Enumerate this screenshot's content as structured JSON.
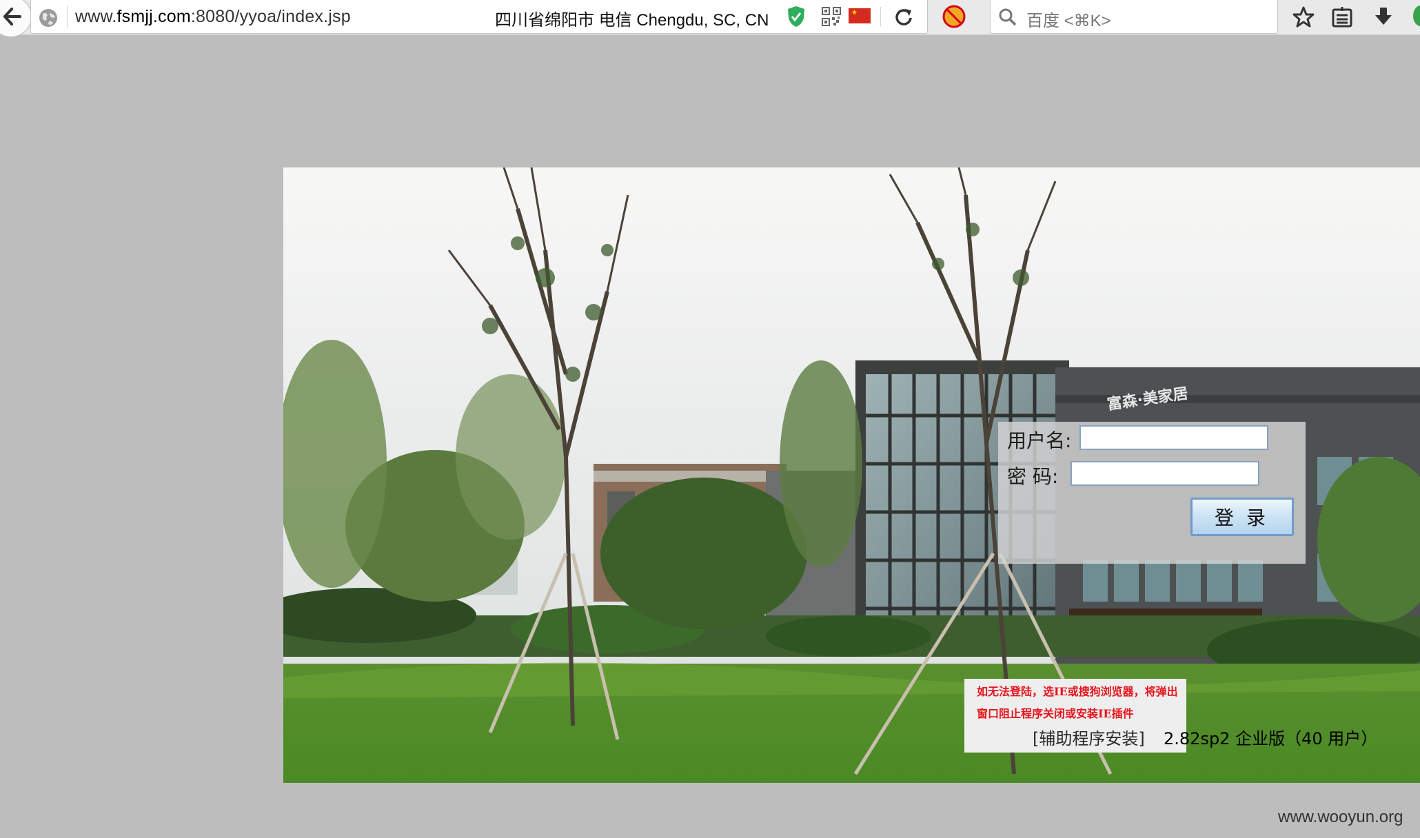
{
  "browser": {
    "url_prefix": "www.",
    "url_host": "fsmjj.com",
    "url_rest": ":8080/yyoa/index.jsp",
    "geo_location": "四川省绵阳市 电信   Chengdu, SC, CN",
    "search_placeholder": "百度 <⌘K>",
    "icons": [
      "back-arrow-icon",
      "globe-icon",
      "shield-icon",
      "qr-code-icon",
      "china-flag-icon",
      "reload-icon",
      "blocked-addon-icon",
      "search-icon",
      "star-icon",
      "reading-list-icon",
      "download-icon"
    ]
  },
  "login": {
    "username_label": "用户名:",
    "password_label": "密  码:",
    "username_value": "",
    "password_value": "",
    "submit_label": "登录"
  },
  "notice": {
    "warning": "如无法登陆，选IE或搜狗浏览器，将弹出窗口阻止程序关闭或安装IE插件",
    "assist_link": "[辅助程序安装]",
    "version": "2.82sp2 企业版（40 用户）"
  },
  "building_sign": "富森·美家居",
  "watermark": "www.wooyun.org",
  "colors": {
    "page_background": "#bebdbe",
    "notice_red": "#e8121b",
    "button_border": "#6f9bc8"
  }
}
